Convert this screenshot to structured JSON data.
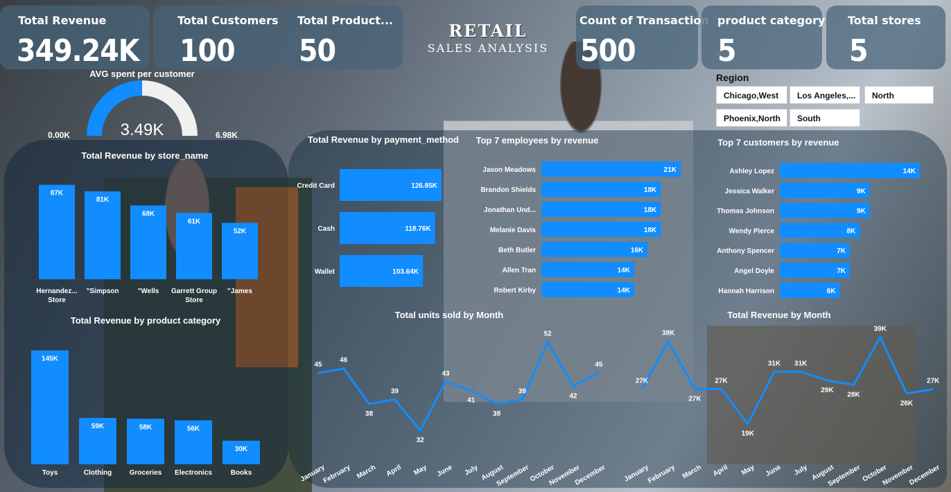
{
  "kpis": [
    {
      "label": "Total Revenue",
      "value": "349.24K"
    },
    {
      "label": "Total Customers",
      "value": "100"
    },
    {
      "label": "Total Product...",
      "value": "50"
    },
    {
      "label": "Count of Transaction",
      "value": "500"
    },
    {
      "label": "product category",
      "value": "5"
    },
    {
      "label": "Total stores",
      "value": "5"
    }
  ],
  "header": {
    "title": "RETAIL",
    "subtitle": "SALES ANALYSIS"
  },
  "region": {
    "title": "Region",
    "options": [
      "Chicago,West",
      "Los Angeles,...",
      "North",
      "Phoenix,North",
      "South"
    ]
  },
  "colors": {
    "bar": "#118dff",
    "line": "#118dff",
    "gauge_bg": "#f0f0f0"
  },
  "chart_data": [
    {
      "type": "gauge",
      "title": "AVG spent per customer",
      "value": 3.49,
      "display": "3.49K",
      "min_label": "0.00K",
      "max_label": "6.98K",
      "min": 0,
      "max": 6.98
    },
    {
      "type": "bar",
      "title": "Total Revenue by store_name",
      "categories": [
        "Hernandez... Store",
        "\"Simpson",
        "\"Wells",
        "Garrett Group Store",
        "\"James"
      ],
      "values": [
        87,
        81,
        68,
        61,
        52
      ],
      "labels": [
        "87K",
        "81K",
        "68K",
        "61K",
        "52K"
      ],
      "ylim": [
        0,
        90
      ]
    },
    {
      "type": "bar",
      "title": "Total Revenue by product category",
      "categories": [
        "Toys",
        "Clothing",
        "Groceries",
        "Electronics",
        "Books"
      ],
      "values": [
        145,
        59,
        58,
        56,
        30
      ],
      "labels": [
        "145K",
        "59K",
        "58K",
        "56K",
        "30K"
      ],
      "ylim": [
        0,
        150
      ]
    },
    {
      "type": "bar",
      "orientation": "horizontal",
      "title": "Total Revenue by payment_method",
      "categories": [
        "Credit Card",
        "Cash",
        "Wallet"
      ],
      "values": [
        126.85,
        118.76,
        103.64
      ],
      "labels": [
        "126.85K",
        "118.76K",
        "103.64K"
      ]
    },
    {
      "type": "bar",
      "orientation": "horizontal",
      "title": "Top 7 employees by revenue",
      "categories": [
        "Jason Meadows",
        "Brandon Shields",
        "Jonathan Und...",
        "Melanie Davis",
        "Beth Butler",
        "Allen Tran",
        "Robert Kirby"
      ],
      "values": [
        21,
        18,
        18,
        18,
        16,
        14,
        14
      ],
      "labels": [
        "21K",
        "18K",
        "18K",
        "18K",
        "16K",
        "14K",
        "14K"
      ]
    },
    {
      "type": "bar",
      "orientation": "horizontal",
      "title": "Top 7 customers by revenue",
      "categories": [
        "Ashley Lopez",
        "Jessica Walker",
        "Thomas Johnson",
        "Wendy Pierce",
        "Anthony Spencer",
        "Angel Doyle",
        "Hannah Harrison"
      ],
      "values": [
        14,
        9,
        9,
        8,
        7,
        7,
        6
      ],
      "labels": [
        "14K",
        "9K",
        "9K",
        "8K",
        "7K",
        "7K",
        "6K"
      ]
    },
    {
      "type": "line",
      "title": "Total units sold by Month",
      "x": [
        "January",
        "February",
        "March",
        "April",
        "May",
        "June",
        "July",
        "August",
        "September",
        "October",
        "November",
        "December"
      ],
      "values": [
        45,
        46,
        38,
        39,
        32,
        43,
        41,
        38,
        39,
        52,
        42,
        45
      ],
      "labels": [
        "45",
        "46",
        "38",
        "39",
        "32",
        "43",
        "41",
        "38",
        "39",
        "52",
        "42",
        "45"
      ],
      "ylim": [
        30,
        53
      ]
    },
    {
      "type": "line",
      "title": "Total Revenue by Month",
      "x": [
        "January",
        "February",
        "March",
        "April",
        "May",
        "June",
        "July",
        "August",
        "September",
        "October",
        "November",
        "December"
      ],
      "values": [
        27,
        38,
        27,
        27,
        19,
        31,
        31,
        29,
        28,
        39,
        26,
        27
      ],
      "labels": [
        "27K",
        "38K",
        "27K",
        "27K",
        "19K",
        "31K",
        "31K",
        "29K",
        "28K",
        "39K",
        "26K",
        "27K"
      ],
      "ylim": [
        18,
        40
      ]
    }
  ]
}
